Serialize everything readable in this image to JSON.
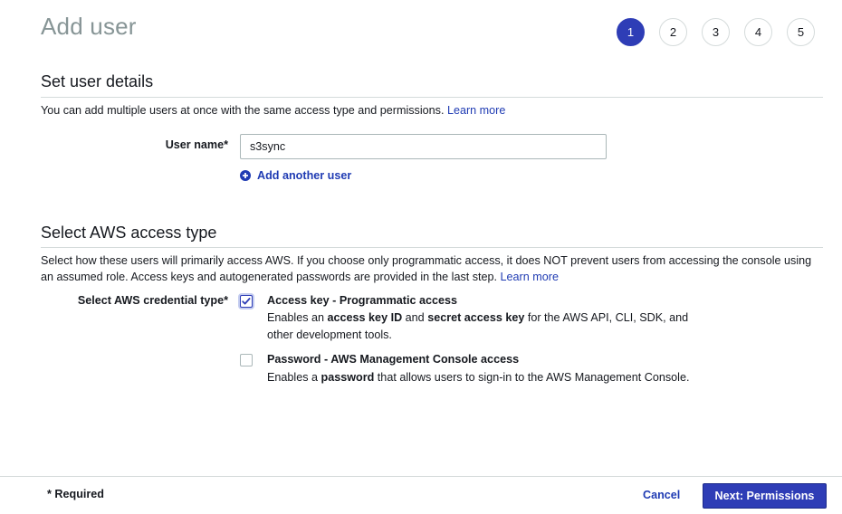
{
  "page": {
    "title": "Add user"
  },
  "wizard": {
    "steps": [
      "1",
      "2",
      "3",
      "4",
      "5"
    ],
    "active_step": "1"
  },
  "user_details": {
    "heading": "Set user details",
    "description": "You can add multiple users at once with the same access type and permissions.",
    "learn_more": "Learn more",
    "user_name_label": "User name*",
    "user_name_value": "s3sync",
    "add_another_label": "Add another user",
    "add_icon": "plus-circle-icon"
  },
  "access_type": {
    "heading": "Select AWS access type",
    "description": "Select how these users will primarily access AWS. If you choose only programmatic access, it does NOT prevent users from accessing the console using an assumed role. Access keys and autogenerated passwords are provided in the last step.",
    "learn_more": "Learn more",
    "credential_label": "Select AWS credential type*",
    "options": [
      {
        "title": "Access key - Programmatic access",
        "checked": true,
        "desc_parts": [
          "Enables an ",
          "access key ID",
          " and ",
          "secret access key",
          " for the AWS API, CLI, SDK, and",
          "other development tools."
        ]
      },
      {
        "title": "Password - AWS Management Console access",
        "checked": false,
        "desc_parts": [
          "Enables a ",
          "password",
          " that allows users to sign-in to the AWS Management Console."
        ]
      }
    ]
  },
  "footer": {
    "required_note": "* Required",
    "cancel_label": "Cancel",
    "next_label": "Next: Permissions"
  },
  "colors": {
    "accent": "#2e3db6",
    "link": "#1f3bb3",
    "title_gray": "#879596",
    "border": "#d5dbdb"
  }
}
